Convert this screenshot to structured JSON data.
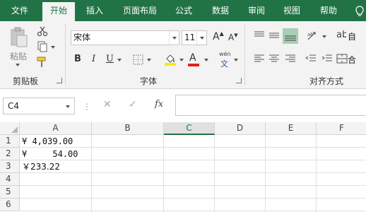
{
  "tabs": {
    "file": "文件",
    "home": "开始",
    "insert": "插入",
    "page_layout": "页面布局",
    "formulas": "公式",
    "data": "数据",
    "review": "审阅",
    "view": "视图",
    "help": "帮助",
    "tell_me_icon": "lightbulb-icon"
  },
  "ribbon": {
    "clipboard": {
      "group_label": "剪贴板",
      "paste_label": "粘贴",
      "icons": [
        "paste-icon",
        "cut-icon",
        "copy-icon",
        "format-painter-icon"
      ]
    },
    "font": {
      "group_label": "字体",
      "font_name": "宋体",
      "font_size": "11",
      "grow_label": "A",
      "shrink_label": "A",
      "bold": "B",
      "italic": "I",
      "underline": "U",
      "font_color_letter": "A",
      "phonetic": "wén",
      "phonetic_char": "文",
      "fill_color": "#f9e81a",
      "font_color": "#e3211c"
    },
    "alignment": {
      "group_label": "对齐方式",
      "wrap_fragment": "自",
      "merge_fragment": "合",
      "orientation_fragment": "ab"
    }
  },
  "formula_bar": {
    "name_box": "C4",
    "fx": "fx",
    "formula": ""
  },
  "sheet": {
    "columns": [
      "A",
      "B",
      "C",
      "D",
      "E",
      "F"
    ],
    "rows": [
      "1",
      "2",
      "3",
      "4",
      "5",
      "6"
    ],
    "selected_column": "C",
    "cells": {
      "A1": "¥ 4,039.00",
      "A2": "¥     54.00",
      "A3": "￥233.22"
    }
  },
  "colors": {
    "brand": "#217346",
    "ribbon_bg": "#f3f3f3",
    "header_bg": "#f3f3f3",
    "gridline": "#e0e0e0"
  }
}
